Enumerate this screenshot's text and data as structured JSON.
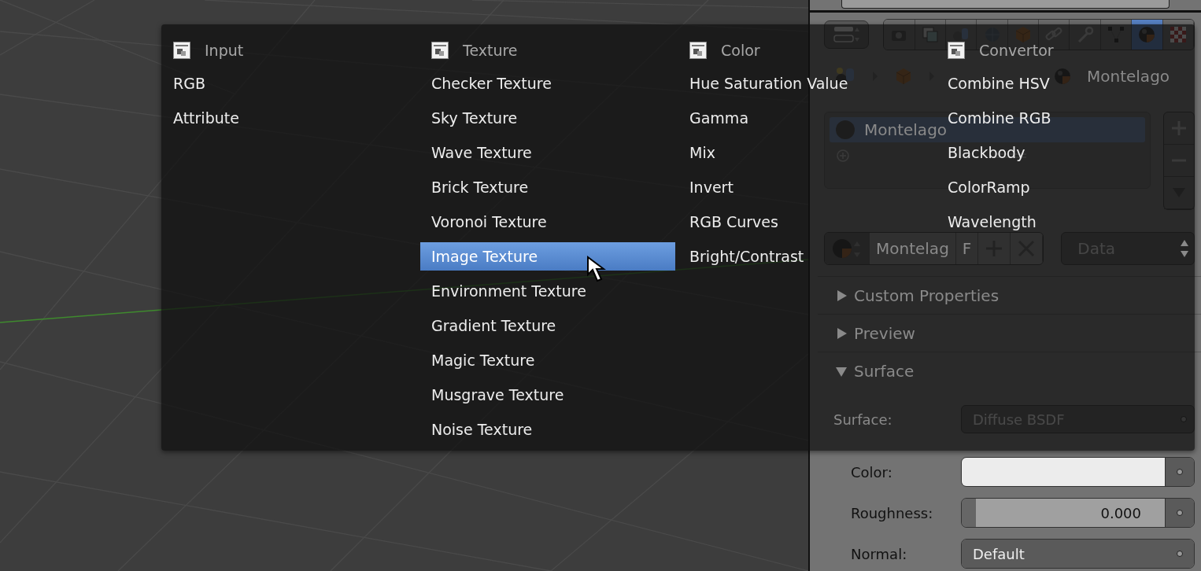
{
  "properties_panel": {
    "toolbar": {
      "tabs": [
        {
          "kind": "camera",
          "selected": false
        },
        {
          "kind": "layers",
          "selected": false
        },
        {
          "kind": "scene",
          "selected": false
        },
        {
          "kind": "world",
          "selected": false
        },
        {
          "kind": "cube",
          "selected": false
        },
        {
          "kind": "chain",
          "selected": false
        },
        {
          "kind": "wrench",
          "selected": false
        },
        {
          "kind": "vertices",
          "selected": false
        },
        {
          "kind": "sphere",
          "selected": true
        },
        {
          "kind": "checker",
          "selected": false
        }
      ]
    },
    "breadcrumb": {
      "label": "Montelago"
    },
    "material_slots": [
      {
        "label": "Montelago",
        "selected": true
      }
    ],
    "material_id": {
      "name": "Montelag",
      "fake_user": "F",
      "link": "Data"
    },
    "sections": [
      {
        "title": "Custom Properties",
        "expanded": false
      },
      {
        "title": "Preview",
        "expanded": false
      },
      {
        "title": "Surface",
        "expanded": true
      }
    ],
    "surface": {
      "label": "Surface:",
      "value": "Diffuse BSDF"
    },
    "inputs": [
      {
        "kind": "color",
        "label": "Color:"
      },
      {
        "kind": "slider",
        "label": "Roughness:",
        "value": "0.000"
      },
      {
        "kind": "dropdown",
        "label": "Normal:",
        "value": "Default"
      }
    ]
  },
  "add_menu": {
    "columns": [
      {
        "title": "Input",
        "items": [
          {
            "label": "RGB",
            "selected": false
          },
          {
            "label": "Attribute",
            "selected": false
          }
        ]
      },
      {
        "title": "Texture",
        "items": [
          {
            "label": "Checker Texture",
            "selected": false
          },
          {
            "label": "Sky Texture",
            "selected": false
          },
          {
            "label": "Wave Texture",
            "selected": false
          },
          {
            "label": "Brick Texture",
            "selected": false
          },
          {
            "label": "Voronoi Texture",
            "selected": false
          },
          {
            "label": "Image Texture",
            "selected": true
          },
          {
            "label": "Environment Texture",
            "selected": false
          },
          {
            "label": "Gradient Texture",
            "selected": false
          },
          {
            "label": "Magic Texture",
            "selected": false
          },
          {
            "label": "Musgrave Texture",
            "selected": false
          },
          {
            "label": "Noise Texture",
            "selected": false
          }
        ]
      },
      {
        "title": "Color",
        "items": [
          {
            "label": "Hue Saturation Value",
            "selected": false
          },
          {
            "label": "Gamma",
            "selected": false
          },
          {
            "label": "Mix",
            "selected": false
          },
          {
            "label": "Invert",
            "selected": false
          },
          {
            "label": "RGB Curves",
            "selected": false
          },
          {
            "label": "Bright/Contrast",
            "selected": false
          }
        ]
      },
      {
        "title": "Convertor",
        "items": [
          {
            "label": "Combine HSV",
            "selected": false
          },
          {
            "label": "Combine RGB",
            "selected": false
          },
          {
            "label": "Blackbody",
            "selected": false
          },
          {
            "label": "ColorRamp",
            "selected": false
          },
          {
            "label": "Wavelength",
            "selected": false
          }
        ]
      }
    ]
  }
}
